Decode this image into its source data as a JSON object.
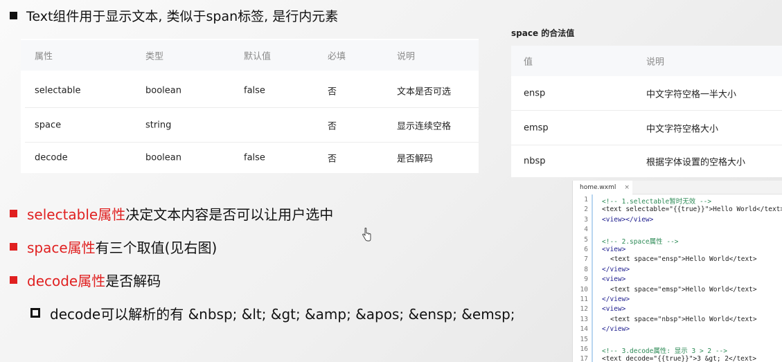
{
  "title": {
    "text": "Text组件用于显示文本, 类似于span标签, 是行内元素"
  },
  "props_table": {
    "headers": [
      "属性",
      "类型",
      "默认值",
      "必填",
      "说明"
    ],
    "rows": [
      [
        "selectable",
        "boolean",
        "false",
        "否",
        "文本是否可选"
      ],
      [
        "space",
        "string",
        "",
        "否",
        "显示连续空格"
      ],
      [
        "decode",
        "boolean",
        "false",
        "否",
        "是否解码"
      ]
    ]
  },
  "space_table": {
    "title": "space 的合法值",
    "headers": [
      "值",
      "说明"
    ],
    "rows": [
      [
        "ensp",
        "中文字符空格一半大小"
      ],
      [
        "emsp",
        "中文字符空格大小"
      ],
      [
        "nbsp",
        "根据字体设置的空格大小"
      ]
    ]
  },
  "bullets": [
    {
      "highlight": "selectable属性",
      "rest": "决定文本内容是否可以让用户选中"
    },
    {
      "highlight": "space属性",
      "rest": "有三个取值(见右图)"
    },
    {
      "highlight": "decode属性",
      "rest": "是否解码"
    }
  ],
  "sub_bullet": {
    "text": "decode可以解析的有 &nbsp; &lt; &gt; &amp; &apos; &ensp; &emsp;"
  },
  "editor": {
    "tab_label": "home.wxml",
    "tab_close": "×",
    "lines": [
      {
        "n": "1",
        "t": "<!-- 1.selectable暂时无效 -->"
      },
      {
        "n": "2",
        "t": "<text selectable=\"{{true}}\">Hello World</text>"
      },
      {
        "n": "3",
        "t": "<view></view>"
      },
      {
        "n": "4",
        "t": ""
      },
      {
        "n": "5",
        "t": "<!-- 2.space属性 -->"
      },
      {
        "n": "6",
        "t": "<view>"
      },
      {
        "n": "7",
        "t": "<text space=\"ensp\">Hello World</text>"
      },
      {
        "n": "8",
        "t": "</view>"
      },
      {
        "n": "9",
        "t": "<view>"
      },
      {
        "n": "10",
        "t": "<text space=\"emsp\">Hello World</text>"
      },
      {
        "n": "11",
        "t": "</view>"
      },
      {
        "n": "12",
        "t": "<view>"
      },
      {
        "n": "13",
        "t": "<text space=\"nbsp\">Hello World</text>"
      },
      {
        "n": "14",
        "t": "</view>"
      },
      {
        "n": "15",
        "t": ""
      },
      {
        "n": "16",
        "t": "<!-- 3.decode属性: 显示 3 > 2 -->"
      },
      {
        "n": "17",
        "t": "<text decode=\"{{true}}\">3 &gt; 2</text>"
      }
    ]
  },
  "colors": {
    "accent_red": "#e02020",
    "code_comment": "#2e8b57",
    "code_attr": "#d03030"
  }
}
